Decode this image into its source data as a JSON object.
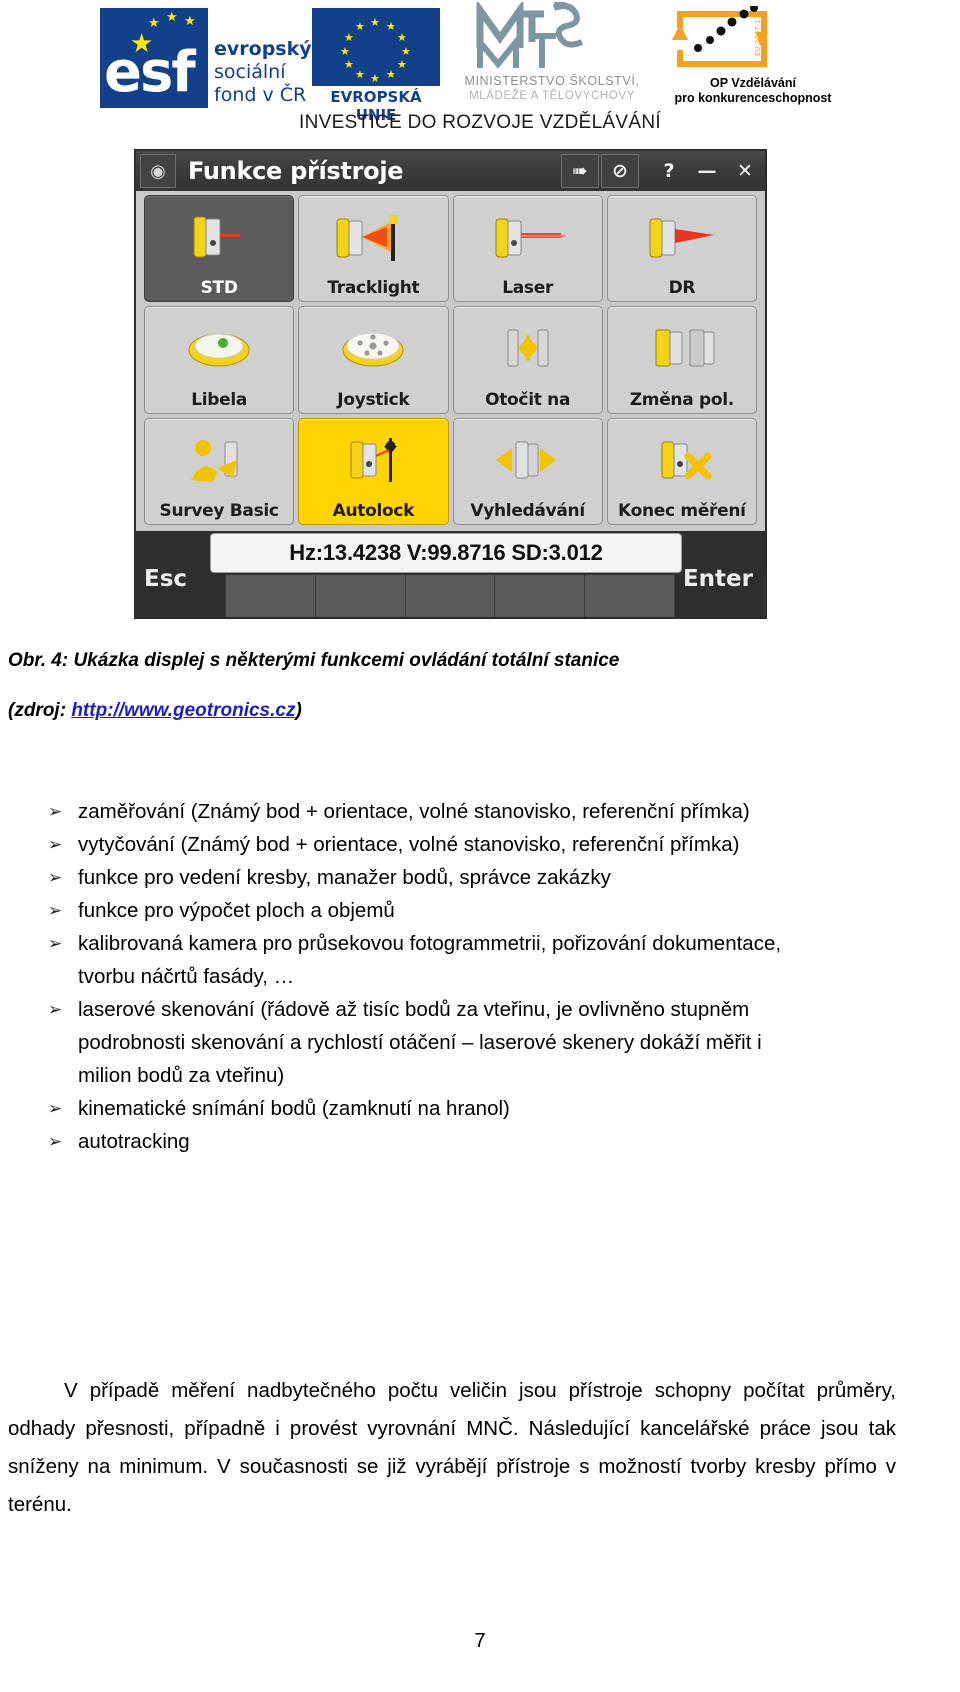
{
  "header": {
    "esf": {
      "line1": "evropský",
      "line2": "sociální",
      "line3": "fond v ČR",
      "mark": "esf"
    },
    "eu": {
      "caption": "EVROPSKÁ UNIE"
    },
    "msmt": {
      "line1": "MINISTERSTVO ŠKOLSTVÍ,",
      "line2": "MLÁDEŽE A TĚLOVÝCHOVY"
    },
    "opvk": {
      "line1": "OP Vzdělávání",
      "line2": "pro konkurenceschopnost"
    },
    "banner": "INVESTICE DO ROZVOJE VZDĚLÁVÁNÍ",
    "colors": {
      "eu_blue": "#13408b",
      "eu_yellow": "#ffe800",
      "opvk_orange": "#f5a01e",
      "msmt_grey": "#9a9a9a"
    }
  },
  "device": {
    "window_title": "Funkce přístroje",
    "app_icon": "device-settings-icon",
    "titlebar_buttons": [
      {
        "name": "connect-icon",
        "glyph": "➠"
      },
      {
        "name": "no-entry-icon",
        "glyph": "⊘"
      },
      {
        "name": "help-button",
        "glyph": "?"
      },
      {
        "name": "minimize-button",
        "glyph": "—"
      },
      {
        "name": "close-button",
        "glyph": "✕"
      }
    ],
    "grid": [
      {
        "label": "STD",
        "state": "selected",
        "icon": "total-station-std-icon"
      },
      {
        "label": "Tracklight",
        "state": "normal",
        "icon": "tracklight-icon"
      },
      {
        "label": "Laser",
        "state": "normal",
        "icon": "laser-pointer-icon"
      },
      {
        "label": "DR",
        "state": "normal",
        "icon": "direct-reflex-icon"
      },
      {
        "label": "Libela",
        "state": "normal",
        "icon": "bubble-level-icon"
      },
      {
        "label": "Joystick",
        "state": "normal",
        "icon": "joystick-disc-icon"
      },
      {
        "label": "Otočit na",
        "state": "normal",
        "icon": "turn-to-icon"
      },
      {
        "label": "Změna pol.",
        "state": "normal",
        "icon": "change-face-icon"
      },
      {
        "label": "Survey Basic",
        "state": "normal",
        "icon": "survey-basic-icon"
      },
      {
        "label": "Autolock",
        "state": "active",
        "icon": "autolock-icon"
      },
      {
        "label": "Vyhledávání",
        "state": "normal",
        "icon": "search-target-icon"
      },
      {
        "label": "Konec měření",
        "state": "normal",
        "icon": "end-measurement-icon"
      }
    ],
    "status_readout": "Hz:13.4238  V:99.8716  SD:3.012",
    "softkey_left": "Esc",
    "softkey_right": "Enter"
  },
  "caption": {
    "line1": "Obr. 4: Ukázka displej s některými funkcemi ovládání totální stanice",
    "line2_prefix": "(zdroj: ",
    "line2_link": "http://www.geotronics.cz",
    "line2_suffix": ")"
  },
  "bullets": {
    "marker": "➢",
    "items": [
      "zaměřování (Známý bod + orientace, volné stanovisko, referenční přímka)",
      "vytyčování (Známý bod + orientace, volné stanovisko, referenční přímka)",
      "funkce pro vedení kresby, manažer bodů, správce zakázky",
      "funkce pro výpočet ploch a objemů",
      "kalibrovaná kamera pro průsekovou fotogrammetrii, pořizování dokumentace,",
      "tvorbu náčrtů fasády, …",
      "laserové skenování (řádově až tisíc bodů za vteřinu, je ovlivněno stupněm",
      "podrobnosti skenování a rychlostí otáčení – laserové skenery dokáží měřit i",
      "milion bodů za vteřinu)",
      "kinematické snímání bodů (zamknutí na hranol)",
      "autotracking"
    ],
    "continuation_indices": [
      5,
      7,
      8
    ]
  },
  "paragraph": "V případě měření nadbytečného počtu veličin jsou přístroje schopny počítat průměry, odhady přesnosti, případně i provést vyrovnání MNČ. Následující kancelářské práce jsou tak sníženy na minimum. V současnosti se již vyrábějí přístroje s možností tvorby kresby přímo v terénu.",
  "page_number": "7"
}
